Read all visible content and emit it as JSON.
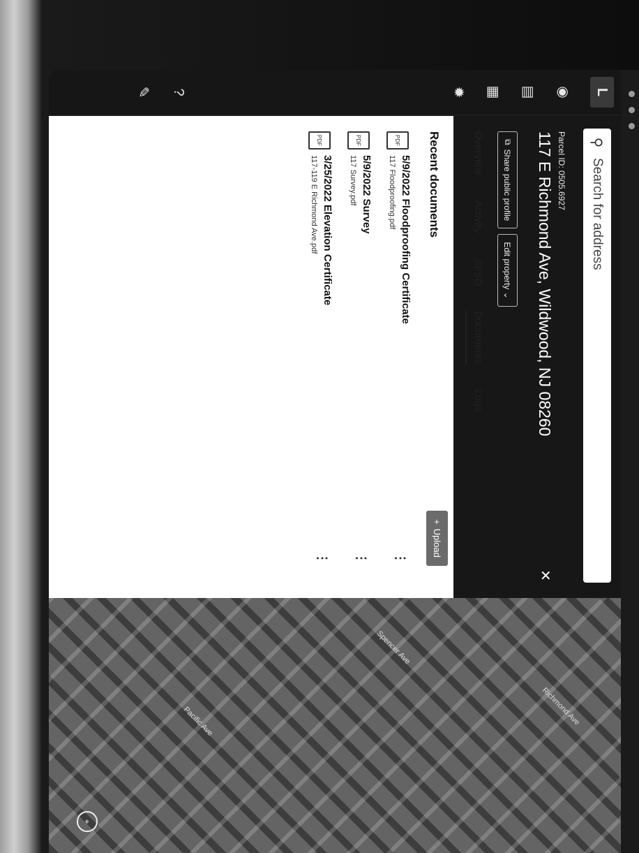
{
  "search": {
    "placeholder": "Search for address"
  },
  "logo": "L",
  "rail": {
    "icons": [
      "globe-icon",
      "document-icon",
      "calculator-icon",
      "gear-icon",
      "help-icon",
      "bug-icon"
    ],
    "glyphs": [
      "◉",
      "▤",
      "▦",
      "✹",
      "?",
      "✎"
    ]
  },
  "property": {
    "parcel_id": "Parcel ID: 0505.6927",
    "address": "117 E Richmond Ave, Wildwood, NJ 08260",
    "share_label": "Share public profile",
    "edit_label": "Edit property ⌄"
  },
  "tabs": [
    "Overview",
    "Activity",
    "SI/SD",
    "Documents",
    "Logs"
  ],
  "active_tab": "Documents",
  "documents": {
    "section_title": "Recent documents",
    "upload_label": "Upload",
    "items": [
      {
        "title": "5/9/2022 Floodproofing Certificate",
        "file": "117 Floodproofing.pdf"
      },
      {
        "title": "5/9/2022 Survey",
        "file": "117 Survey.pdf"
      },
      {
        "title": "3/25/2022 Elevation Certificate",
        "file": "117-119 E Richmond Ave.pdf"
      }
    ]
  },
  "map": {
    "streets": [
      "Richmond Ave",
      "Spencer Ave",
      "Pacific Ave"
    ]
  }
}
